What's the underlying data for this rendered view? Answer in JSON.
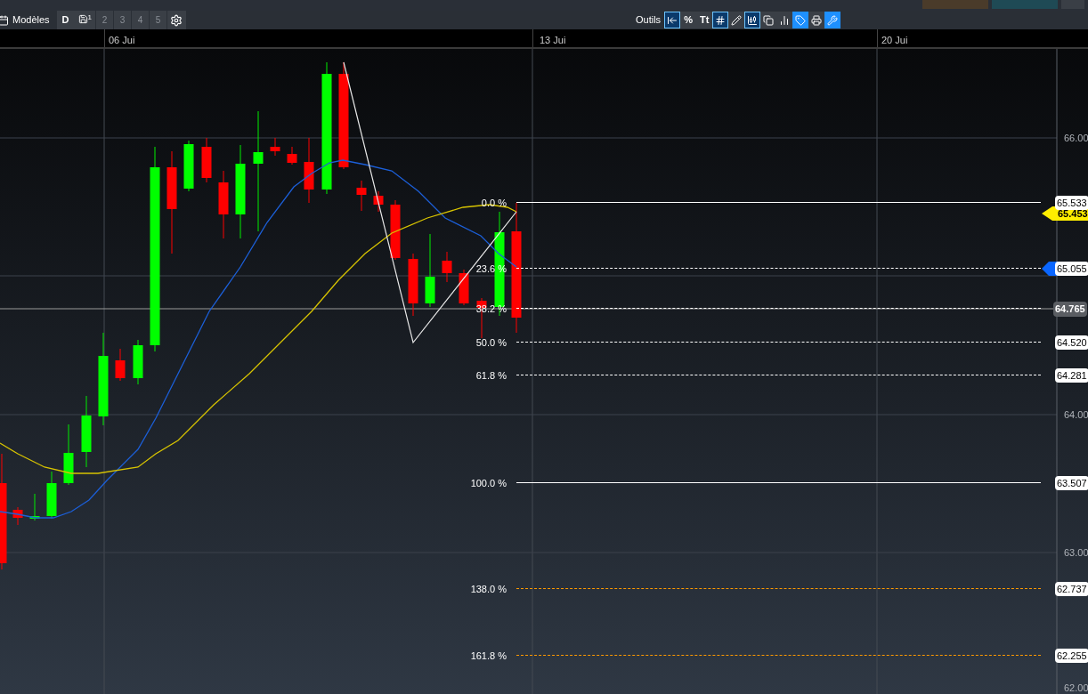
{
  "toolbar": {
    "templates_label": "Modèles",
    "day": "D",
    "save_badge": "1",
    "slots": [
      {
        "label": "2",
        "disabled": true
      },
      {
        "label": "3",
        "disabled": true
      },
      {
        "label": "4",
        "disabled": true
      },
      {
        "label": "5",
        "disabled": true
      }
    ],
    "tools_label": "Outils",
    "tools": [
      {
        "kind": "icon",
        "selected": true,
        "highlighted": false
      },
      {
        "kind": "text",
        "label": "%",
        "selected": false,
        "highlighted": false
      },
      {
        "kind": "text",
        "label": "Tt",
        "selected": false,
        "highlighted": false
      },
      {
        "kind": "icon",
        "selected": true,
        "highlighted": false
      },
      {
        "kind": "icon",
        "selected": false,
        "highlighted": false
      },
      {
        "kind": "icon",
        "selected": true,
        "highlighted": false
      },
      {
        "kind": "icon",
        "selected": false,
        "highlighted": false
      },
      {
        "kind": "icon",
        "selected": false,
        "highlighted": false
      },
      {
        "kind": "icon",
        "selected": false,
        "highlighted": true
      },
      {
        "kind": "icon",
        "selected": false,
        "highlighted": false
      },
      {
        "kind": "icon",
        "selected": false,
        "highlighted": true
      }
    ]
  },
  "dates": [
    "06 Jui",
    "13 Jui",
    "20 Jui"
  ],
  "price_axis": [
    "66.00",
    "64.00",
    "63.00",
    "62.00"
  ],
  "fibonacci": [
    {
      "label": "0.0 %",
      "price": "65.533",
      "dashed": false,
      "color": "#ffffff"
    },
    {
      "label": "23.6 %",
      "price": "65.055",
      "dashed": true,
      "color": "#ffffff"
    },
    {
      "label": "38.2 %",
      "dashed": true,
      "color": "#ffffff"
    },
    {
      "label": "50.0 %",
      "price": "64.520",
      "dashed": true,
      "color": "#ffffff"
    },
    {
      "label": "61.8 %",
      "price": "64.281",
      "dashed": true,
      "color": "#ffffff"
    },
    {
      "label": "100.0 %",
      "price": "63.507",
      "dashed": false,
      "color": "#ffffff"
    },
    {
      "label": "138.0 %",
      "price": "62.737",
      "dashed": true,
      "color": "#ff9900"
    },
    {
      "label": "161.8 %",
      "price": "62.255",
      "dashed": true,
      "color": "#ff9900"
    }
  ],
  "markers": [
    {
      "kind": "tag",
      "price": "65.453",
      "color": "#ffee00"
    },
    {
      "kind": "arrow",
      "color": "#0a66ff"
    }
  ],
  "current_price": "64.765"
}
